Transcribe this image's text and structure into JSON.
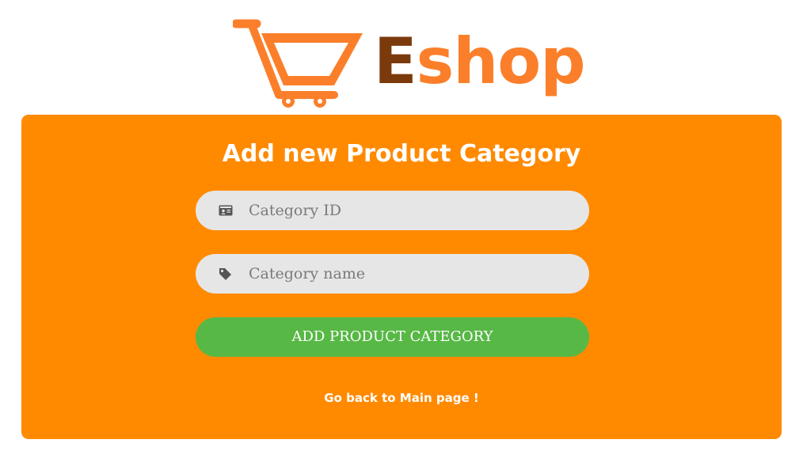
{
  "logo": {
    "icon": "shopping-cart-icon",
    "word_first": "E",
    "word_rest": "shop",
    "colors": {
      "cart": "#fb7f2a",
      "first_letter": "#7b3a0c",
      "rest": "#fb7f2a"
    }
  },
  "card": {
    "title": "Add new Product Category",
    "background": "#ff8a00",
    "fields": {
      "category_id": {
        "icon": "id-card-icon",
        "placeholder": "Category ID",
        "value": ""
      },
      "category_name": {
        "icon": "tag-icon",
        "placeholder": "Category name",
        "value": ""
      }
    },
    "submit_label": "ADD PRODUCT CATEGORY",
    "submit_color": "#57b846",
    "back_link": "Go back to Main page !"
  }
}
